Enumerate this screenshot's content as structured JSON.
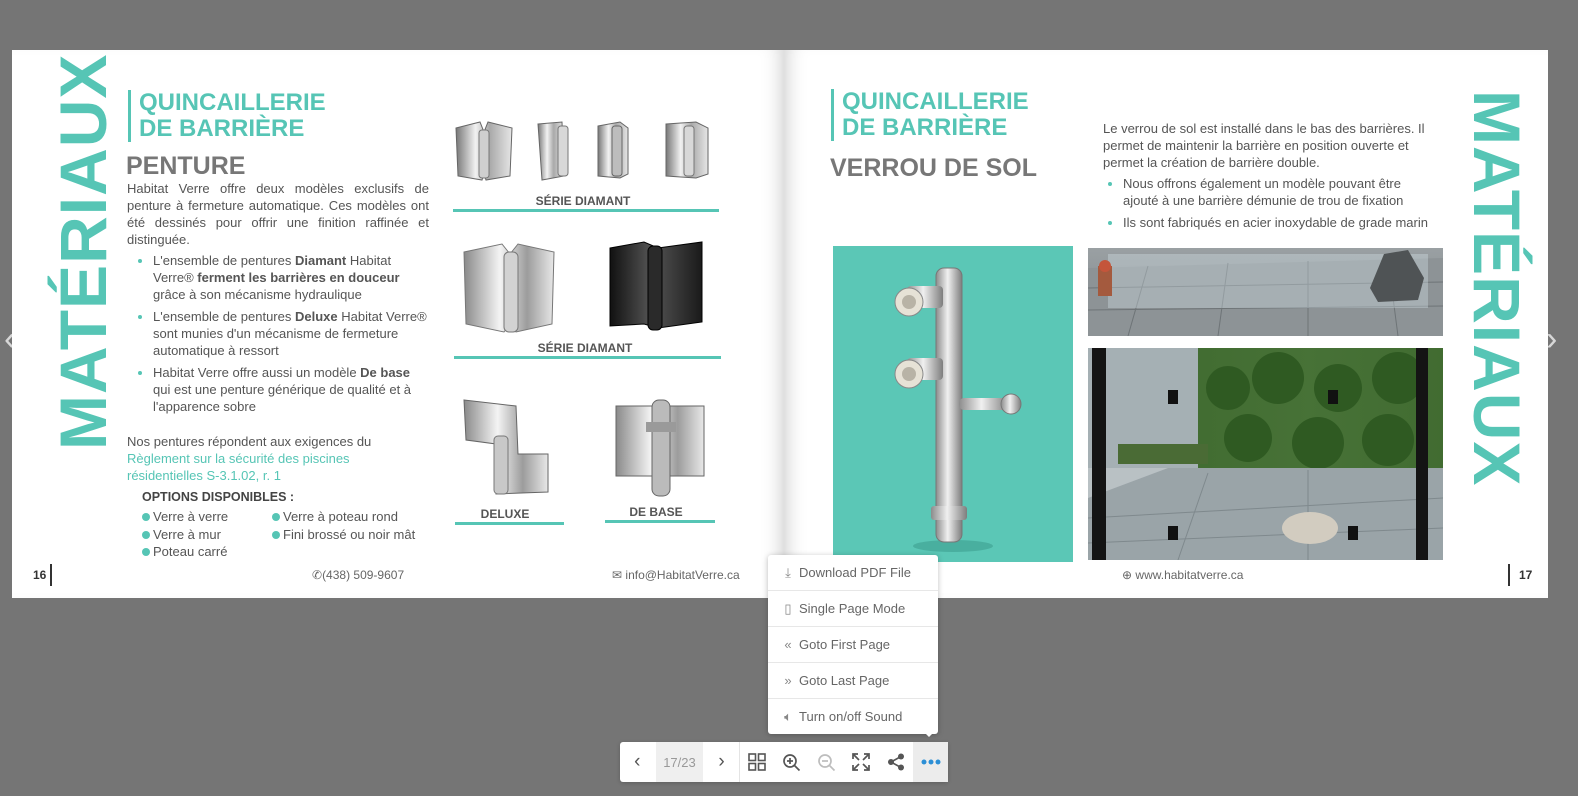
{
  "left_page": {
    "vertical_title": "MATÉRIAUX",
    "section_title_line1": "QUINCAILLERIE",
    "section_title_line2": "DE BARRIÈRE",
    "subtitle": "PENTURE",
    "intro": "Habitat Verre offre deux modèles exclusifs de penture à fermeture automatique. Ces modèles ont été dessinés pour offrir une finition raffinée et distinguée.",
    "bullets": [
      {
        "pre": "L'ensemble de pentures ",
        "bold": "Diamant",
        "mid": " Habitat Verre® ",
        "bold2": "ferment les barrières en douceur",
        "post": " grâce à son mécanisme hydraulique"
      },
      {
        "pre": "L'ensemble de pentures ",
        "bold": "Deluxe",
        "mid": " Habitat Verre® sont munies d'un mécanisme de fermeture automatique à ressort",
        "bold2": "",
        "post": ""
      },
      {
        "pre": "Habitat Verre offre aussi un modèle ",
        "bold": "De base",
        "mid": " qui est une penture générique de qualité et à l'apparence sobre",
        "bold2": "",
        "post": ""
      }
    ],
    "regulation_text": "Nos pentures répondent aux exigences du",
    "regulation_link": "Règlement sur la sécurité des piscines résidentielles S-3.1.02, r. 1",
    "options_title": "OPTIONS DISPONIBLES :",
    "options_col1": [
      "Verre à verre",
      "Verre à mur",
      "Poteau carré"
    ],
    "options_col2": [
      "Verre à poteau rond",
      "Fini brossé ou noir mât"
    ],
    "captions": {
      "serie1": "SÉRIE DIAMANT",
      "serie2": "SÉRIE DIAMANT",
      "deluxe": "DELUXE",
      "debase": "DE BASE"
    },
    "page_number": "16",
    "phone": "(438) 509-9607",
    "email": "info@HabitatVerre.ca"
  },
  "right_page": {
    "vertical_title": "MATÉRIAUX",
    "section_title_line1": "QUINCAILLERIE",
    "section_title_line2": "DE BARRIÈRE",
    "subtitle": "VERROU DE SOL",
    "intro": "Le verrou de sol est installé dans le bas des barrières. Il permet de maintenir la barrière en position ouverte et permet la création de barrière double.",
    "bullets": [
      "Nous offrons également un modèle pouvant être ajouté à une barrière démunie de trou de fixation",
      "Ils sont fabriqués en acier inoxydable de grade marin"
    ],
    "website": "www.habitatverre.ca",
    "page_number": "17"
  },
  "menu": {
    "items": [
      {
        "label": "Download PDF File",
        "icon": "download-icon"
      },
      {
        "label": "Single Page Mode",
        "icon": "page-icon"
      },
      {
        "label": "Goto First Page",
        "icon": "double-chevron-left-icon"
      },
      {
        "label": "Goto Last Page",
        "icon": "double-chevron-right-icon"
      },
      {
        "label": "Turn on/off Sound",
        "icon": "sound-icon"
      }
    ]
  },
  "toolbar": {
    "page_counter": "17/23",
    "accent_color": "#2c8fd6"
  },
  "colors": {
    "teal": "#56c5b5",
    "background": "#757575"
  }
}
